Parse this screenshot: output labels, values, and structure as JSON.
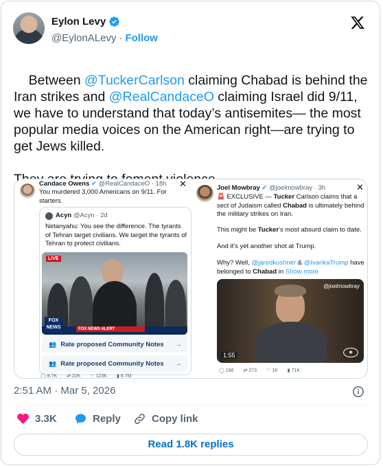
{
  "author": {
    "display_name": "Eylon Levy",
    "handle": "@EylonALevy",
    "follow_label": "Follow"
  },
  "tweet": {
    "segments": [
      {
        "text": "Between ",
        "type": "text"
      },
      {
        "text": "@TuckerCarlson",
        "type": "mention"
      },
      {
        "text": " claiming Chabad is behind the Iran strikes and ",
        "type": "text"
      },
      {
        "text": "@RealCandaceO",
        "type": "mention"
      },
      {
        "text": " claiming Israel did 9/11, we have to understand that today’s antisemites— the most popular media voices on the American right—are trying to get Jews killed.\n\nThey are trying to foment violence.",
        "type": "text"
      }
    ]
  },
  "embed_left": {
    "name": "Candace Owens",
    "handle_time": "@RealCandaceO · 18h",
    "text": "You murdered 3,000 Americans on 9/11. For starters.",
    "quote": {
      "name": "Acyn",
      "handle_time": "@Acyn · 2d",
      "text": "Netanyahu: You see the difference. The tyrants of Tehran target civilians. We target the tyrants of Tehran to protect civilians.",
      "live_badge": "LIVE",
      "chyron": "FOX NEWS ALERT",
      "network": "FOX NEWS"
    },
    "notes_label": "Rate proposed Community Notes",
    "metrics": [
      "8.7K",
      "22K",
      "123K",
      "6.7M"
    ]
  },
  "embed_right": {
    "name": "Joel Mowbray",
    "handle_time": "@joelmowbray · 3h",
    "exclusive_prefix": "🚨 EXCLUSIVE — ",
    "exclusive_bold": "Tucker",
    "exclusive_rest_1": " Carlson claims that a sect of Judaism called ",
    "exclusive_bold_2": "Chabad",
    "exclusive_rest_2": " is ultimately behind the military strikes on Iran.",
    "p2_pre": "This might be ",
    "p2_bold": "Tucker",
    "p2_post": "'s most absurd claim to date.",
    "p3": "And it's yet another shot at Trump.",
    "p4_pre": "Why? Well, ",
    "p4_m1": "@jaredkushner",
    "p4_mid": " & ",
    "p4_m2": "@IvankaTrump",
    "p4_post": " have belonged to ",
    "p4_bold": "Chabad",
    "p4_in": " in ",
    "show_more": "Show more",
    "video_watermark": "@joelmowbray",
    "video_time": "1:55",
    "metrics": [
      "186",
      "273",
      "1K",
      "71K"
    ]
  },
  "timestamp": "2:51 AM · Mar 5, 2026",
  "actions": {
    "like_count": "3.3K",
    "reply_label": "Reply",
    "copy_link_label": "Copy link"
  },
  "read_replies_label": "Read 1.8K replies",
  "colors": {
    "accent": "#1d9bf0",
    "like": "#f91880",
    "reply": "#1d9bf0",
    "secondary_text": "#536471",
    "border": "#cfd9de"
  }
}
